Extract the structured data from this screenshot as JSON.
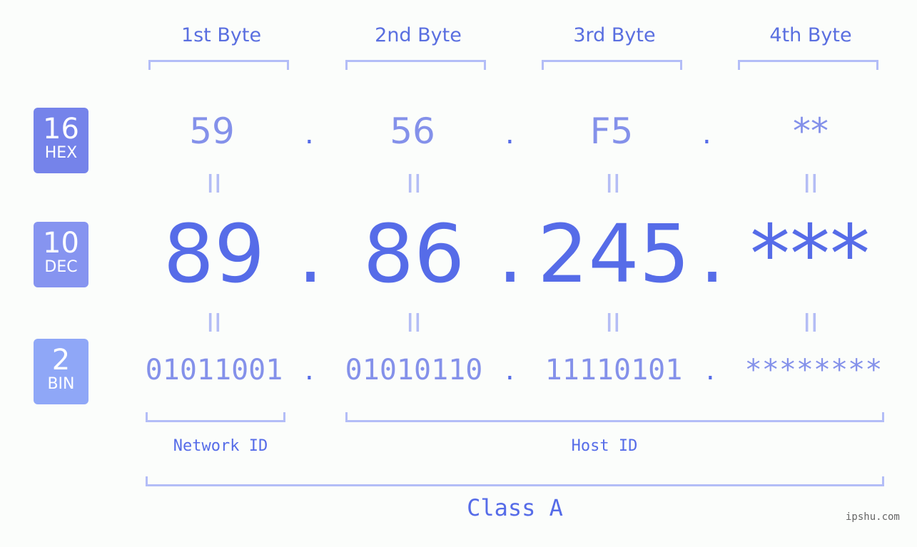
{
  "headers": [
    "1st Byte",
    "2nd Byte",
    "3rd Byte",
    "4th Byte"
  ],
  "badges": [
    {
      "num": "16",
      "label": "HEX",
      "color": "#7583ea"
    },
    {
      "num": "10",
      "label": "DEC",
      "color": "#8694f0"
    },
    {
      "num": "2",
      "label": "BIN",
      "color": "#8fa7f7"
    }
  ],
  "hex": [
    "59",
    "56",
    "F5",
    "**"
  ],
  "dec": [
    "89",
    "86",
    "245",
    "***"
  ],
  "bin": [
    "01011001",
    "01010110",
    "11110101",
    "********"
  ],
  "separator": ".",
  "equals": "II",
  "network_label": "Network ID",
  "host_label": "Host ID",
  "class_label": "Class A",
  "watermark": "ipshu.com"
}
